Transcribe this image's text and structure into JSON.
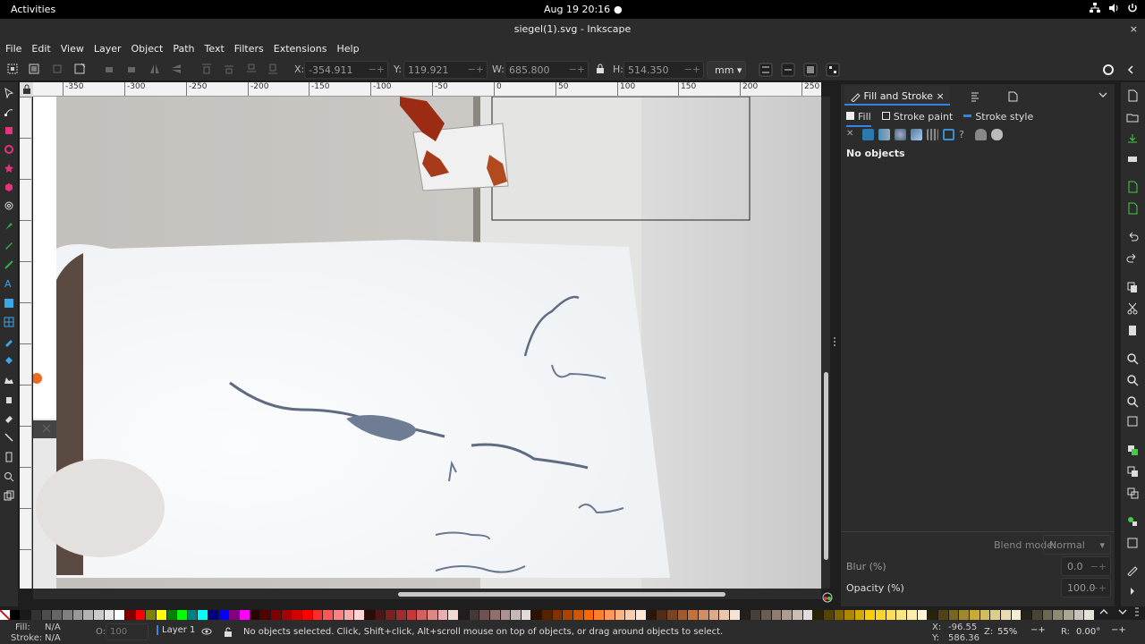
{
  "topbar": {
    "activities": "Activities",
    "clock": "Aug 19  20:16",
    "dot": "●"
  },
  "window": {
    "title": "siegel(1).svg - Inkscape",
    "close": "×"
  },
  "menu": [
    "File",
    "Edit",
    "View",
    "Layer",
    "Object",
    "Path",
    "Text",
    "Filters",
    "Extensions",
    "Help"
  ],
  "toolbar": {
    "x_label": "X:",
    "x_value": "-354.911",
    "y_label": "Y:",
    "y_value": "119.921",
    "w_label": "W:",
    "w_value": "685.800",
    "h_label": "H:",
    "h_value": "514.350",
    "unit": "mm",
    "spin_marks": "−+"
  },
  "ruler": {
    "ticks": [
      "-350",
      "-300",
      "-250",
      "-200",
      "-150",
      "-100",
      "-50",
      "0",
      "50",
      "100",
      "150",
      "200",
      "250"
    ]
  },
  "panel": {
    "tab_label": "Fill and Stroke",
    "tab_close": "×",
    "subtabs": [
      "Fill",
      "Stroke paint",
      "Stroke style"
    ],
    "no_objects": "No objects",
    "blend_label": "Blend mode:",
    "blend_value": "Normal",
    "blur_label": "Blur (%)",
    "blur_value": "0.0",
    "opacity_label": "Opacity (%)",
    "opacity_value": "100.0"
  },
  "status": {
    "fill_label": "Fill:",
    "fill_value": "N/A",
    "stroke_label": "Stroke:",
    "stroke_value": "N/A",
    "o_label": "O:",
    "o_value": "100",
    "layer": "Layer 1",
    "message": "No objects selected. Click, Shift+click, Alt+scroll mouse on top of objects, or drag around objects to select.",
    "cx_label": "X:",
    "cx_value": "-96.55",
    "cy_label": "Y:",
    "cy_value": "586.36",
    "zoom_label": "Z:",
    "zoom_value": "55%",
    "rot_label": "R:",
    "rot_value": "0.00°"
  },
  "palette": [
    "#000000",
    "#1a1a1a",
    "#333333",
    "#4d4d4d",
    "#666666",
    "#808080",
    "#999999",
    "#b3b3b3",
    "#cccccc",
    "#e6e6e6",
    "#ffffff",
    "#800000",
    "#ff0000",
    "#808000",
    "#ffff00",
    "#008000",
    "#00ff00",
    "#008080",
    "#00ffff",
    "#000080",
    "#0000ff",
    "#800080",
    "#ff00ff",
    "#2b0000",
    "#550000",
    "#800000",
    "#aa0000",
    "#d40000",
    "#ff0000",
    "#ff2a2a",
    "#ff5555",
    "#ff8080",
    "#ffaaaa",
    "#ffd5d5",
    "#280b0b",
    "#501616",
    "#782121",
    "#a02c2c",
    "#c83737",
    "#d35f5f",
    "#de8787",
    "#e9afaf",
    "#f4d7d7",
    "#241c1c",
    "#483737",
    "#6c5353",
    "#916f6f",
    "#ac9393",
    "#c8b7b7",
    "#e3dbdb",
    "#2b1100",
    "#552200",
    "#803300",
    "#aa4400",
    "#d45500",
    "#ff6600",
    "#ff7f2a",
    "#ff9955",
    "#ffb380",
    "#ffccaa",
    "#ffe6d5",
    "#28170b",
    "#502d16",
    "#784421",
    "#a05a2c",
    "#c87137",
    "#d38d5f",
    "#deaa87",
    "#e9c6af",
    "#f4e3d7",
    "#241f1c",
    "#483e37",
    "#6c5d53",
    "#917c6f",
    "#ac9d93",
    "#c8beb7",
    "#e3dedb",
    "#2b2200",
    "#554400",
    "#806600",
    "#aa8800",
    "#d4aa00",
    "#ffcc00",
    "#ffd42a",
    "#ffdd55",
    "#ffe680",
    "#ffeeaa",
    "#fff6d5",
    "#28220b",
    "#504416",
    "#786721",
    "#a0892c",
    "#c8ab37",
    "#d3bc5f",
    "#decd87",
    "#e9ddaf",
    "#f4eed7",
    "#24221c",
    "#484537",
    "#6c6753",
    "#918a6f",
    "#aca793",
    "#c8c4b7",
    "#e3e2db"
  ],
  "colors": {
    "accent": "#3584e4",
    "bg": "#2c2c2c",
    "canvas_wall": "#c9c7c4",
    "paper": "#f7f8fa"
  }
}
